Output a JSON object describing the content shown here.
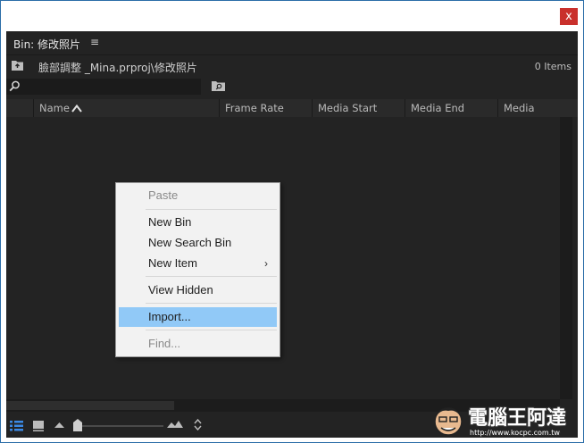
{
  "window": {
    "close_glyph": "x"
  },
  "panel": {
    "title": "Bin: 修改照片",
    "menu_glyph": "≡",
    "path": "臉部調整 _Mina.prproj\\修改照片",
    "item_count": "0 Items",
    "search_placeholder": ""
  },
  "columns": [
    "",
    "Name",
    "Frame Rate",
    "Media Start",
    "Media End",
    "Media Duration"
  ],
  "sort_indicator": "up-triangle",
  "context_menu": {
    "items": [
      {
        "label": "Paste",
        "state": "disabled"
      },
      {
        "label": "New Bin",
        "state": "normal"
      },
      {
        "label": "New Search Bin",
        "state": "normal"
      },
      {
        "label": "New Item",
        "state": "normal",
        "submenu_glyph": "›"
      },
      {
        "label": "View Hidden",
        "state": "normal"
      },
      {
        "label": "Import...",
        "state": "highlighted"
      },
      {
        "label": "Find...",
        "state": "disabled"
      }
    ]
  },
  "watermark": {
    "text": "電腦王阿達",
    "url": "http://www.kocpc.com.tw"
  },
  "colors": {
    "panel_bg": "#232323",
    "header_bg": "#2a2a2a",
    "menu_bg": "#f2f2f2",
    "menu_highlight": "#91c9f7",
    "close_red": "#c9302c",
    "active_blue": "#3b8ae6"
  },
  "icons": {
    "close": "close-icon",
    "folder_up": "folder-up-icon",
    "search": "search-icon",
    "find_bin": "find-bin-icon",
    "list_view": "list-view-icon",
    "icon_view": "icon-view-icon",
    "zoom_out": "zoom-out-icon",
    "zoom_in": "zoom-in-icon",
    "sort": "sort-icon"
  }
}
